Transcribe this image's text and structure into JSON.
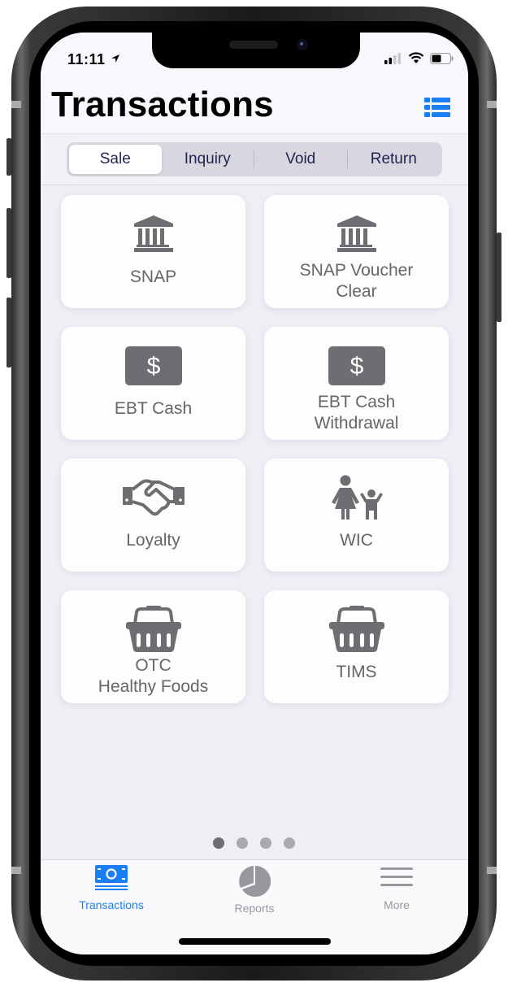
{
  "status_bar": {
    "time": "11:11"
  },
  "header": {
    "title": "Transactions"
  },
  "segments": [
    {
      "label": "Sale",
      "active": true
    },
    {
      "label": "Inquiry",
      "active": false
    },
    {
      "label": "Void",
      "active": false
    },
    {
      "label": "Return",
      "active": false
    }
  ],
  "tiles": [
    {
      "label": "SNAP",
      "icon": "bank-icon"
    },
    {
      "label": "SNAP Voucher\nClear",
      "icon": "bank-icon"
    },
    {
      "label": "EBT Cash",
      "icon": "dollar-bill-icon"
    },
    {
      "label": "EBT Cash\nWithdrawal",
      "icon": "dollar-bill-icon"
    },
    {
      "label": "Loyalty",
      "icon": "handshake-icon"
    },
    {
      "label": "WIC",
      "icon": "mother-child-icon"
    },
    {
      "label": "OTC\nHealthy Foods",
      "icon": "basket-icon"
    },
    {
      "label": "TIMS",
      "icon": "basket-icon"
    }
  ],
  "pager": {
    "pages": 4,
    "current": 1
  },
  "tabbar": [
    {
      "label": "Transactions",
      "icon": "money-icon",
      "active": true
    },
    {
      "label": "Reports",
      "icon": "pie-chart-icon",
      "active": false
    },
    {
      "label": "More",
      "icon": "menu-icon",
      "active": false
    }
  ],
  "colors": {
    "accent": "#1a7ff5",
    "icon_gray": "#6e6d72",
    "inactive_tab": "#98979c",
    "segment_text": "#1c2550"
  }
}
